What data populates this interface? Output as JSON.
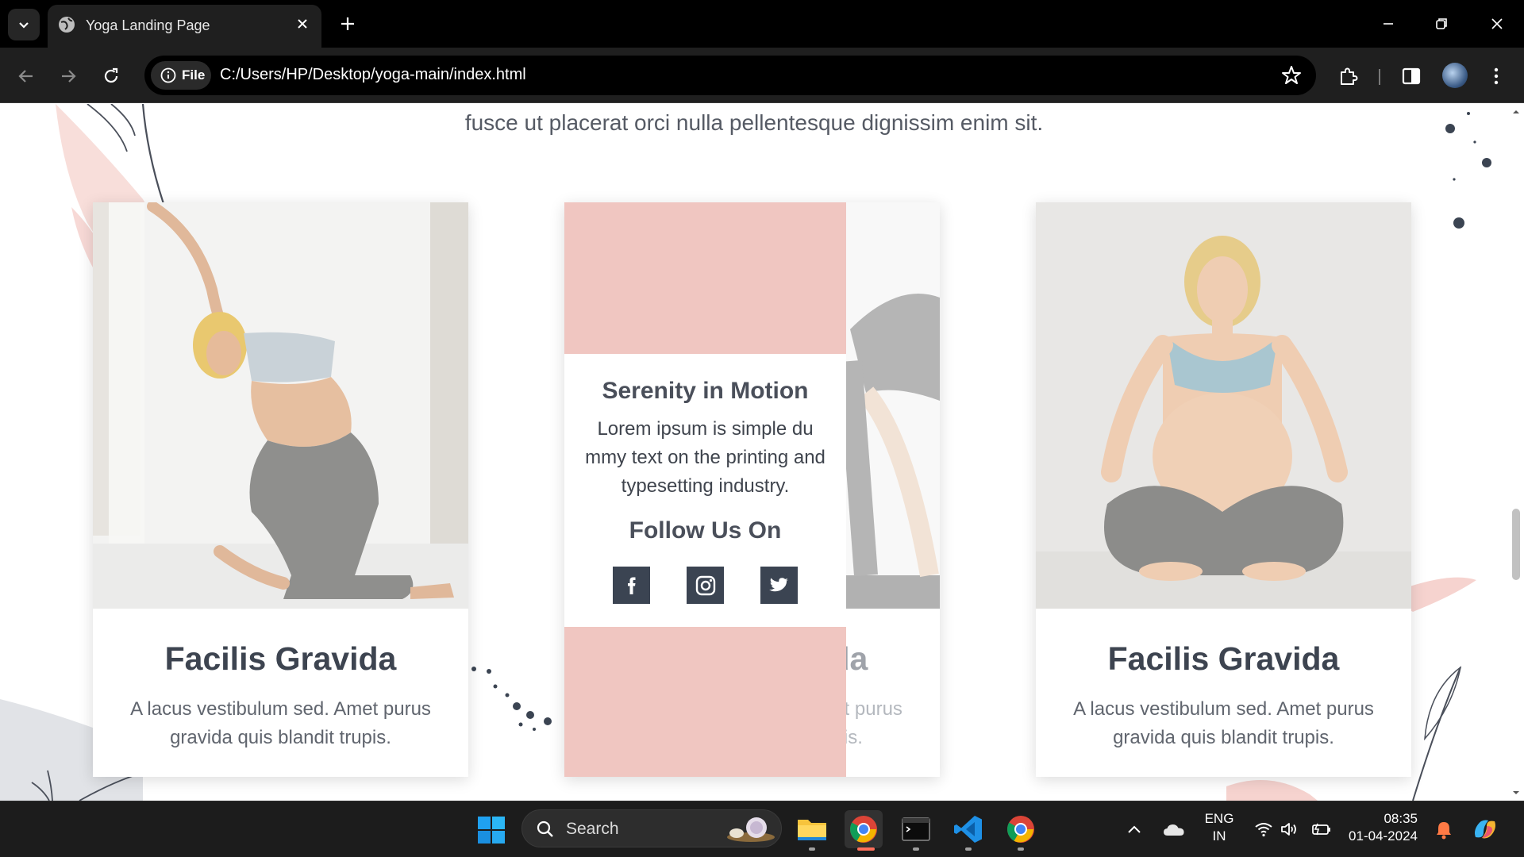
{
  "browser": {
    "tab_title": "Yoga Landing Page",
    "site_chip": "File",
    "url": "C:/Users/HP/Desktop/yoga-main/index.html"
  },
  "page": {
    "intro_text": "fusce ut placerat orci nulla pellentesque dignissim enim sit.",
    "cards": [
      {
        "title": "Facilis Gravida",
        "text": "A lacus vestibulum sed. Amet purus gravida quis blandit trupis."
      },
      {
        "title": "Facilis Gravida",
        "text": "A lacus vestibulum sed. Amet purus gravida quis blandit trupis."
      },
      {
        "title": "Facilis Gravida",
        "text": "A lacus vestibulum sed. Amet purus gravida quis blandit trupis."
      }
    ],
    "overlay": {
      "title": "Serenity in Motion",
      "text": "Lorem ipsum is simple du mmy text on the printing and typesetting industry.",
      "follow": "Follow Us On",
      "social_icons": [
        "facebook-icon",
        "instagram-icon",
        "twitter-icon"
      ]
    }
  },
  "taskbar": {
    "search_label": "Search",
    "lang_line1": "ENG",
    "lang_line2": "IN",
    "time": "08:35",
    "date": "01-04-2024"
  },
  "colors": {
    "accent_pink": "#f0c6c1",
    "dark_slate": "#3b4452",
    "heading": "#3d4450"
  }
}
